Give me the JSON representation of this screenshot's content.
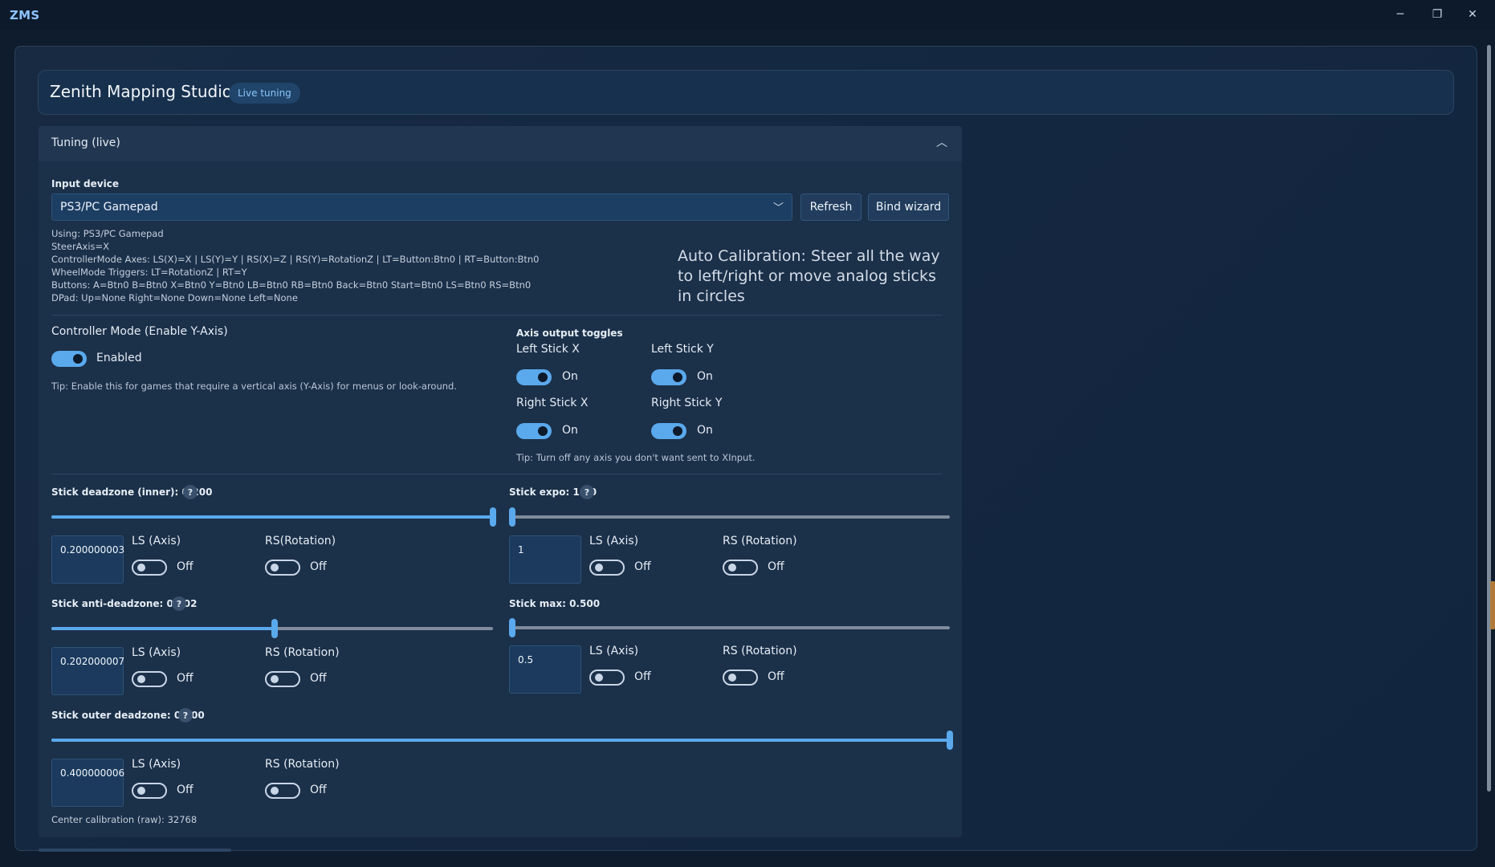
{
  "window": {
    "app_name": "ZMS",
    "minimize": "─",
    "restore": "❐",
    "close": "✕"
  },
  "header": {
    "title": "Zenith Mapping Studio",
    "badge": "Live tuning"
  },
  "tuning": {
    "section_title": "Tuning (live)",
    "input_device_label": "Input device",
    "device_selected": "PS3/PC Gamepad",
    "refresh_label": "Refresh",
    "bind_wizard_label": "Bind wizard",
    "info_lines": [
      "Using: PS3/PC Gamepad",
      "SteerAxis=X",
      "ControllerMode Axes: LS(X)=X | LS(Y)=Y | RS(X)=Z | RS(Y)=RotationZ | LT=Button:Btn0 | RT=Button:Btn0",
      "WheelMode Triggers: LT=RotationZ | RT=Y",
      "Buttons: A=Btn0 B=Btn0 X=Btn0 Y=Btn0 LB=Btn0 RB=Btn0 Back=Btn0 Start=Btn0 LS=Btn0 RS=Btn0",
      "DPad: Up=None Right=None Down=None Left=None"
    ],
    "auto_calibration": "Auto Calibration: Steer all the way to left/right or move analog sticks in circles",
    "controller_mode": {
      "title": "Controller Mode (Enable Y-Axis)",
      "state_label": "Enabled",
      "enabled": true,
      "tip": "Tip: Enable this for games that require a vertical axis (Y-Axis) for menus or look-around."
    },
    "axis_toggles": {
      "title": "Axis output toggles",
      "items": [
        {
          "label": "Left Stick X",
          "state": "On"
        },
        {
          "label": "Left Stick Y",
          "state": "On"
        },
        {
          "label": "Right Stick X",
          "state": "On"
        },
        {
          "label": "Right Stick Y",
          "state": "On"
        }
      ],
      "tip": "Tip: Turn off any axis you don't want sent to XInput."
    },
    "sliders": {
      "deadzone_inner": {
        "label": "Stick deadzone (inner): 0.200",
        "value_fraction": 1.0,
        "box_value": "0.200000003",
        "ls_label": "LS (Axis)",
        "ls_state": "Off",
        "rs_label": "RS(Rotation)",
        "rs_state": "Off"
      },
      "expo": {
        "label": "Stick expo: 1.00",
        "value_fraction": 0.0,
        "box_value": "1",
        "ls_label": "LS (Axis)",
        "ls_state": "Off",
        "rs_label": "RS (Rotation)",
        "rs_state": "Off"
      },
      "anti_deadzone": {
        "label": "Stick anti-deadzone: 0.202",
        "value_fraction": 0.505,
        "box_value": "0.202000007",
        "ls_label": "LS (Axis)",
        "ls_state": "Off",
        "rs_label": "RS (Rotation)",
        "rs_state": "Off"
      },
      "max": {
        "label": "Stick max: 0.500",
        "value_fraction": 0.0,
        "box_value": "0.5",
        "ls_label": "LS (Axis)",
        "ls_state": "Off",
        "rs_label": "RS (Rotation)",
        "rs_state": "Off"
      },
      "outer_deadzone": {
        "label": "Stick outer deadzone: 0.400",
        "value_fraction": 1.0,
        "box_value": "0.400000006",
        "ls_label": "LS (Axis)",
        "ls_state": "Off",
        "rs_label": "RS (Rotation)",
        "rs_state": "Off"
      }
    },
    "center_calibration": "Center calibration (raw): 32768",
    "help_icon": "?"
  },
  "colors": {
    "accent": "#5aa9ec",
    "badge_text": "#8cc6ff",
    "background": "#0f1c2e"
  }
}
